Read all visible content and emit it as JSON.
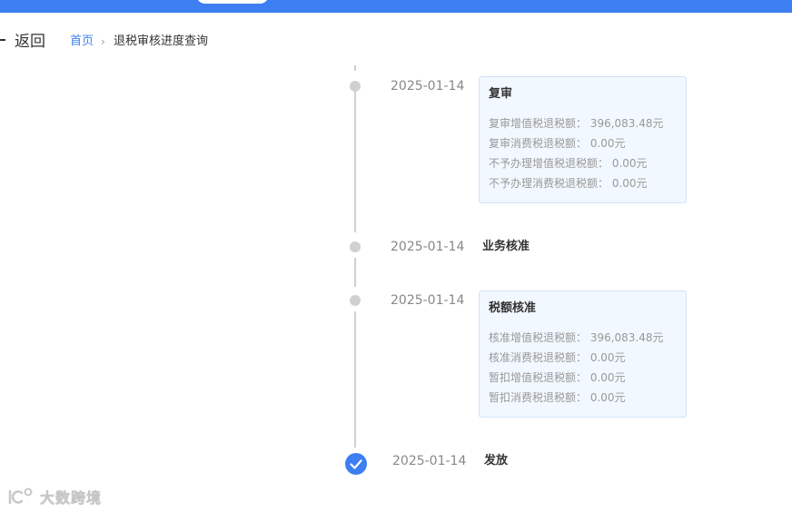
{
  "nav": {
    "back_label": "返回",
    "breadcrumb": {
      "home": "首页",
      "separator": "›",
      "current": "退税审核进度查询"
    }
  },
  "timeline": {
    "items": [
      {
        "date": "2025-01-14",
        "title": "复审",
        "rows": [
          "复审增值税退税额： 396,083.48元",
          "复审消费税退税额： 0.00元",
          "不予办理增值税退税额： 0.00元",
          "不予办理消费税退税额： 0.00元"
        ]
      },
      {
        "date": "2025-01-14",
        "title": "业务核准"
      },
      {
        "date": "2025-01-14",
        "title": "税额核准",
        "rows": [
          "核准增值税退税额： 396,083.48元",
          "核准消费税退税额： 0.00元",
          "暂扣增值税退税额： 0.00元",
          "暂扣消费税退税额： 0.00元"
        ]
      },
      {
        "date": "2025-01-14",
        "title": "发放",
        "status": "completed"
      }
    ]
  },
  "watermark": {
    "text": "大数跨境"
  },
  "colors": {
    "primary": "#3d7ff2",
    "card_bg": "#f2f8ff",
    "card_border": "#cfe3f7",
    "line": "#d0d0d0"
  },
  "icons": [
    "arrow-left-icon",
    "chevron-right-icon",
    "check-icon",
    "watermark-logo-icon"
  ]
}
